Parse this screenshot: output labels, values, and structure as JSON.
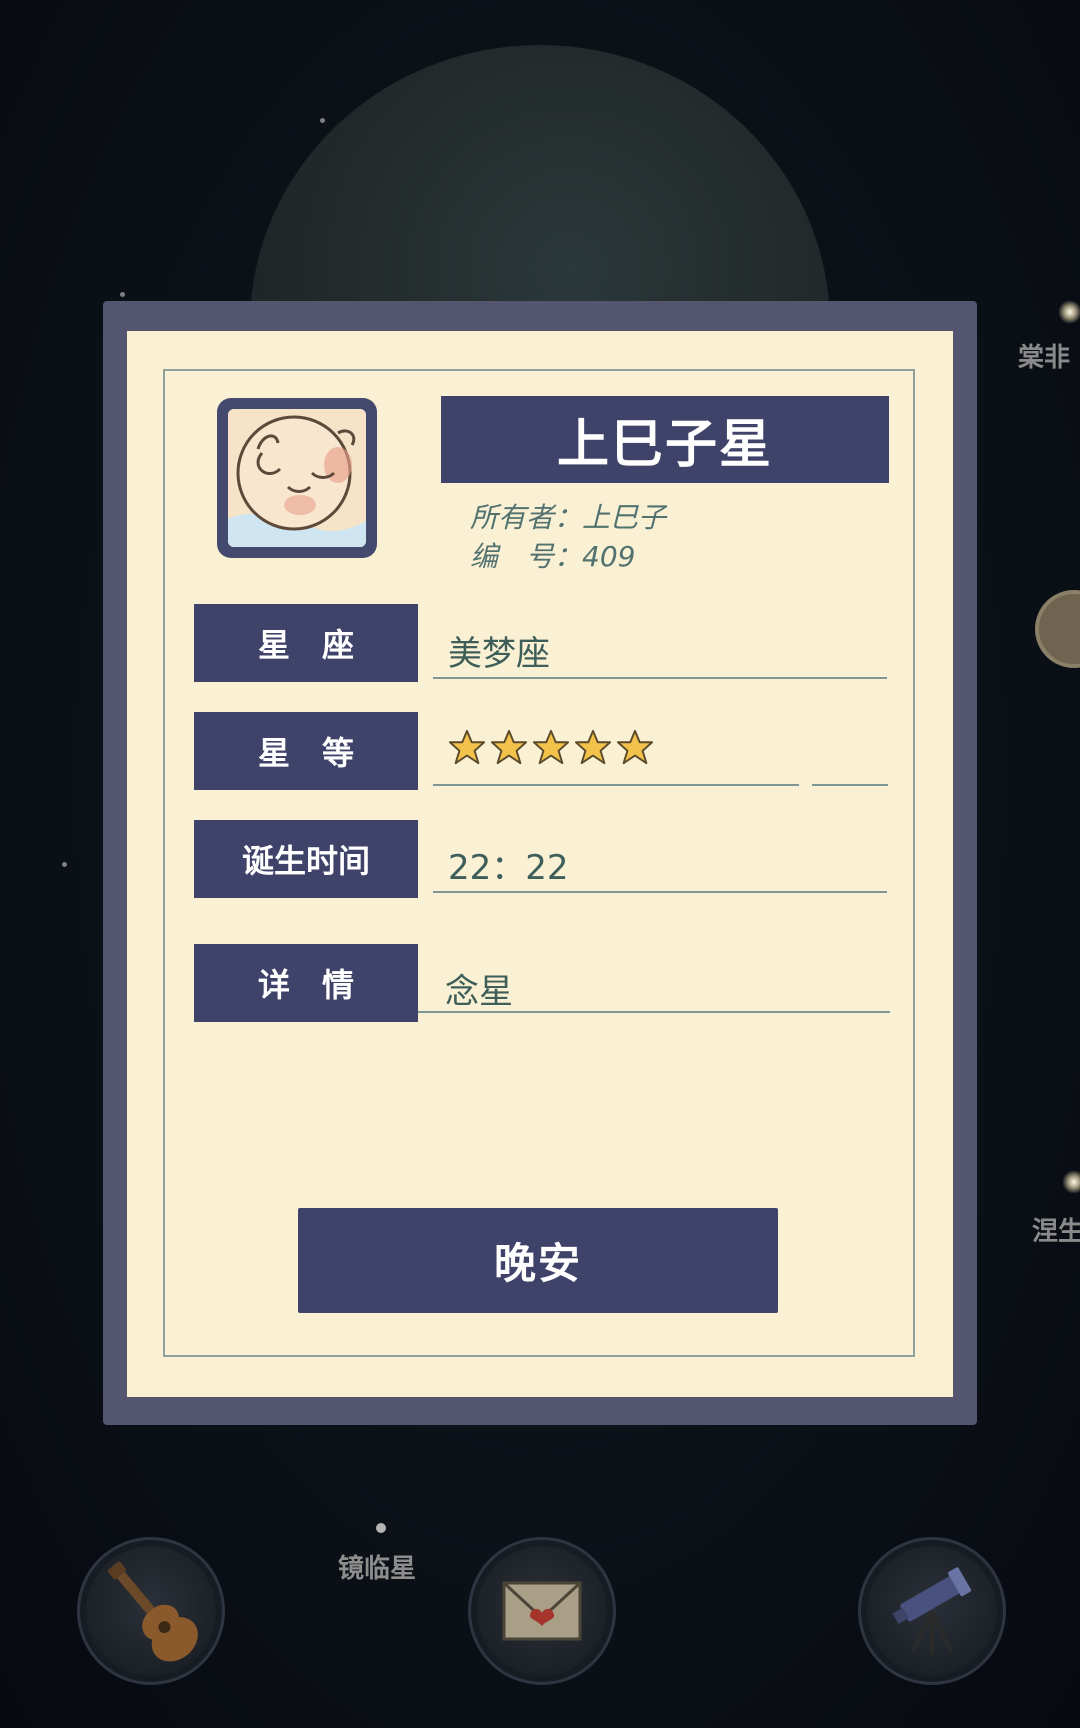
{
  "background": {
    "side_labels": [
      "棠非",
      "涅生"
    ],
    "bottom_bar": {
      "star_label": "镜临星",
      "buttons": [
        {
          "icon": "guitar-icon"
        },
        {
          "icon": "envelope-icon"
        },
        {
          "icon": "telescope-icon"
        }
      ]
    }
  },
  "modal": {
    "title": "上巳子星",
    "avatar_icon": "sleeping-baby-icon",
    "owner_line": "所有者：上巳子",
    "number_line": "编　号：409",
    "fields": {
      "constellation_label": "星　座",
      "constellation_value": "美梦座",
      "magnitude_label": "星　等",
      "magnitude_stars": 5,
      "birth_label": "诞生时间",
      "birth_value": "22：22",
      "details_label": "详　情",
      "details_value": "念星"
    },
    "button_label": "晚安"
  },
  "colors": {
    "panel_frame": "#545670",
    "paper": "#faf0d3",
    "accent": "#3f4369",
    "text_value": "#3e5e5a",
    "star_fill": "#f2c24a"
  }
}
